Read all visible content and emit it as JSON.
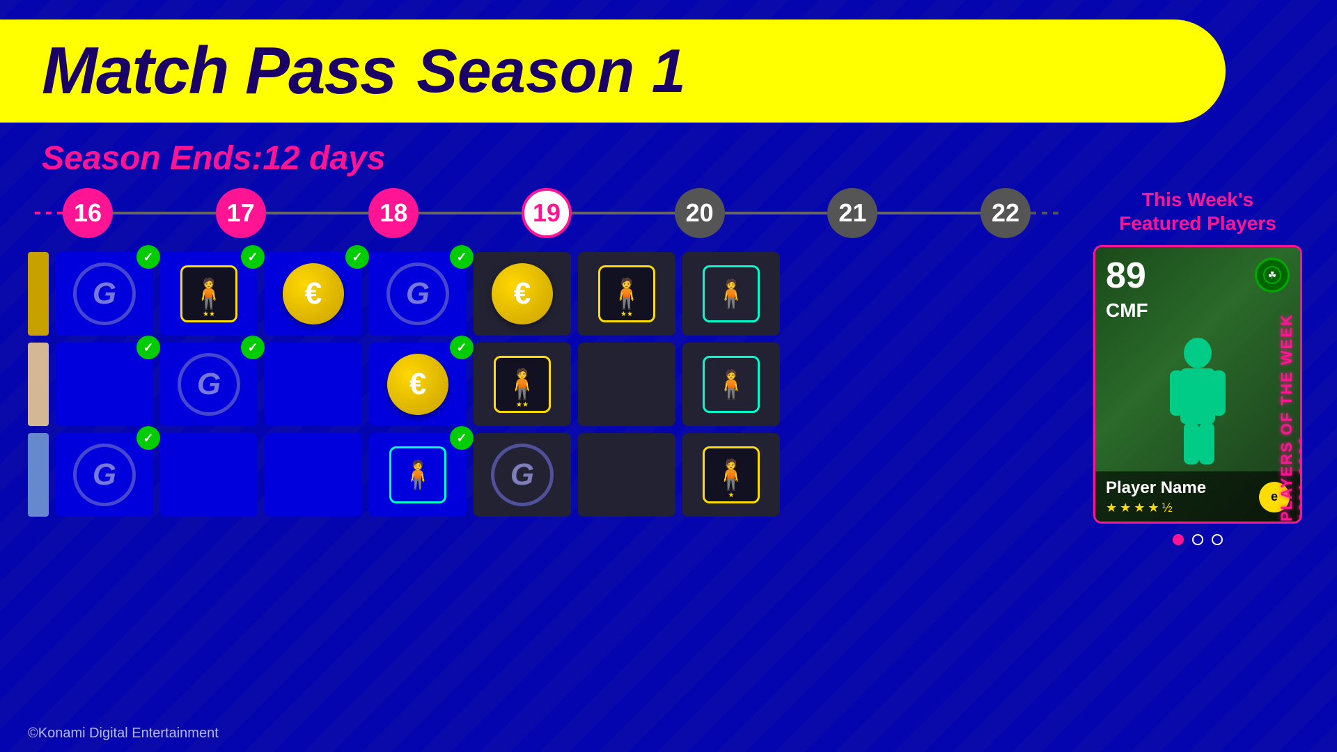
{
  "header": {
    "title": "Match Pass",
    "season": "Season 1"
  },
  "season_ends": "Season Ends:12 days",
  "timeline": {
    "weeks": [
      {
        "number": "16",
        "state": "past"
      },
      {
        "number": "17",
        "state": "past"
      },
      {
        "number": "18",
        "state": "past"
      },
      {
        "number": "19",
        "state": "current"
      },
      {
        "number": "20",
        "state": "future"
      },
      {
        "number": "21",
        "state": "future"
      },
      {
        "number": "22",
        "state": "future"
      }
    ]
  },
  "rows": [
    {
      "indicator": "gold",
      "cells": [
        {
          "type": "g-icon",
          "checked": true,
          "week": 16
        },
        {
          "type": "player-yellow",
          "checked": true,
          "stars": 2,
          "week": 17
        },
        {
          "type": "coin",
          "checked": true,
          "week": 18
        },
        {
          "type": "g-icon",
          "checked": true,
          "week": 19
        },
        {
          "type": "coin",
          "checked": false,
          "week": 20
        },
        {
          "type": "player-yellow",
          "checked": false,
          "stars": 2,
          "week": 21
        },
        {
          "type": "player-cyan",
          "checked": false,
          "week": 22
        }
      ]
    },
    {
      "indicator": "tan",
      "cells": [
        {
          "type": "empty",
          "checked": true,
          "week": 16
        },
        {
          "type": "g-icon",
          "checked": true,
          "week": 17
        },
        {
          "type": "empty",
          "checked": false,
          "week": 18
        },
        {
          "type": "coin",
          "checked": true,
          "week": 19
        },
        {
          "type": "player-yellow",
          "checked": false,
          "stars": 2,
          "week": 20
        },
        {
          "type": "empty",
          "checked": false,
          "week": 21
        },
        {
          "type": "player-cyan",
          "checked": false,
          "week": 22
        }
      ]
    },
    {
      "indicator": "blue",
      "cells": [
        {
          "type": "g-icon",
          "checked": true,
          "week": 16
        },
        {
          "type": "empty",
          "checked": false,
          "week": 17
        },
        {
          "type": "empty",
          "checked": false,
          "week": 18
        },
        {
          "type": "player-cyan-border",
          "checked": true,
          "week": 19
        },
        {
          "type": "g-icon-outline",
          "checked": false,
          "week": 20
        },
        {
          "type": "empty",
          "checked": false,
          "week": 21
        },
        {
          "type": "player-yellow-small",
          "checked": false,
          "stars": 1,
          "week": 22
        }
      ]
    }
  ],
  "featured": {
    "title": "This Week's\nFeatured Players",
    "player": {
      "rating": "89",
      "position": "CMF",
      "name": "Player Name",
      "stars": 4.5
    },
    "dots": [
      {
        "active": true
      },
      {
        "active": false
      },
      {
        "active": false
      }
    ]
  },
  "footer": {
    "copyright": "©Konami Digital Entertainment"
  }
}
